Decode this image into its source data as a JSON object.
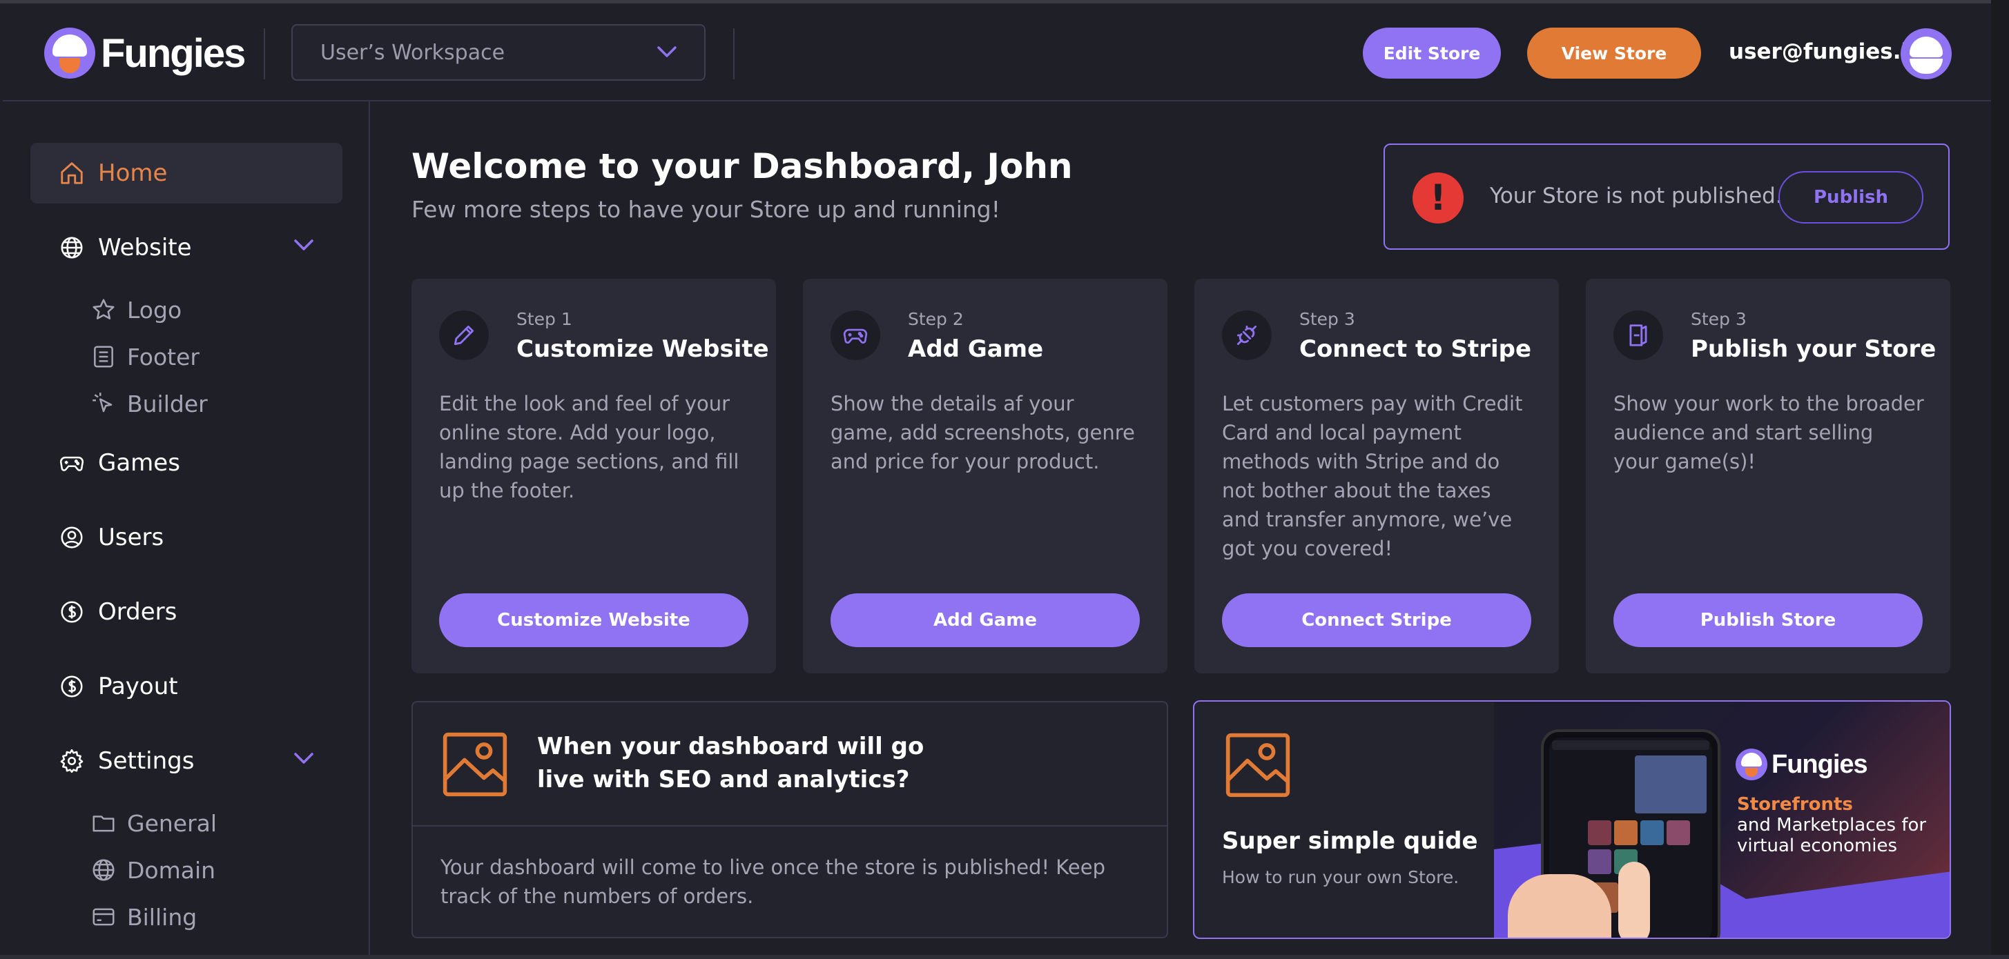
{
  "header": {
    "brand": "Fungies",
    "workspace": "User’s Workspace",
    "edit_store": "Edit Store",
    "view_store": "View Store",
    "email": "user@fungies.io"
  },
  "sidebar": {
    "items": [
      {
        "label": "Home",
        "icon": "home-icon"
      },
      {
        "label": "Website",
        "icon": "globe-icon"
      },
      {
        "label": "Logo",
        "icon": "star-icon"
      },
      {
        "label": "Footer",
        "icon": "footer-icon"
      },
      {
        "label": "Builder",
        "icon": "cursor-icon"
      },
      {
        "label": "Games",
        "icon": "gamepad-icon"
      },
      {
        "label": "Users",
        "icon": "user-icon"
      },
      {
        "label": "Orders",
        "icon": "dollar-icon"
      },
      {
        "label": "Payout",
        "icon": "dollar-icon"
      },
      {
        "label": "Settings",
        "icon": "gear-icon"
      },
      {
        "label": "General",
        "icon": "folder-icon"
      },
      {
        "label": "Domain",
        "icon": "globe-icon"
      },
      {
        "label": "Billing",
        "icon": "card-icon"
      }
    ]
  },
  "main": {
    "title": "Welcome to your Dashboard, John",
    "subtitle": "Few more steps to have your Store up and running!",
    "alert": {
      "message": "Your Store is not published.",
      "button": "Publish"
    },
    "steps": [
      {
        "step": "Step 1",
        "title": "Customize Website",
        "desc": "Edit the look and feel of your online store. Add your logo, landing page sections, and fill up the footer.",
        "button": "Customize Website"
      },
      {
        "step": "Step 2",
        "title": "Add Game",
        "desc": "Show the details af your game, add screenshots, genre and price for your product.",
        "button": "Add Game"
      },
      {
        "step": "Step 3",
        "title": "Connect to Stripe",
        "desc": "Let customers pay with Credit Card and local payment methods with Stripe and do not bother about the taxes and transfer anymore, we’ve got you covered!",
        "button": "Connect Stripe"
      },
      {
        "step": "Step 3",
        "title": "Publish your Store",
        "desc": "Show your work to the broader audience and start selling your game(s)!",
        "button": "Publish Store"
      }
    ],
    "seo": {
      "title": "When your dashboard will go live with SEO and analytics?",
      "desc": "Your dashboard will come to live once the store is published! Keep track of the numbers of orders."
    },
    "guide": {
      "title": "Super simple quide",
      "subtitle": "How to run your own Store.",
      "promo_brand": "Fungies",
      "promo_tag1": "Storefronts",
      "promo_tag2": "and Marketplaces for virtual economies"
    }
  },
  "colors": {
    "accent": "#8f73f2",
    "orange": "#e07a35",
    "alert": "#e53935"
  }
}
